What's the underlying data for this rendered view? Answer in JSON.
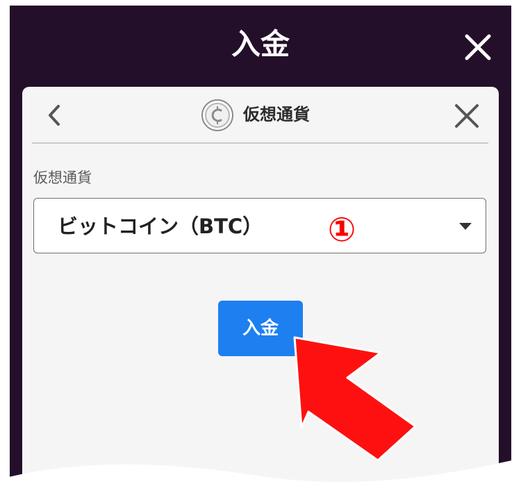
{
  "modal": {
    "title": "入金",
    "close_icon": "close-icon"
  },
  "panel": {
    "back_icon": "chevron-left-icon",
    "currency_icon": "crypto-coin-icon",
    "title": "仮想通貨",
    "close_icon": "close-icon"
  },
  "form": {
    "currency_label": "仮想通貨",
    "currency_selected": "ビットコイン（BTC）",
    "dropdown_icon": "caret-down-icon"
  },
  "annotation": {
    "step_number": "①",
    "arrow_icon": "red-pointer-arrow-icon"
  },
  "actions": {
    "deposit_label": "入金"
  },
  "colors": {
    "modal_background": "#240f2b",
    "panel_background": "#f5f5f6",
    "primary_button": "#1e7ff0",
    "annotation_red": "#ff0000"
  }
}
